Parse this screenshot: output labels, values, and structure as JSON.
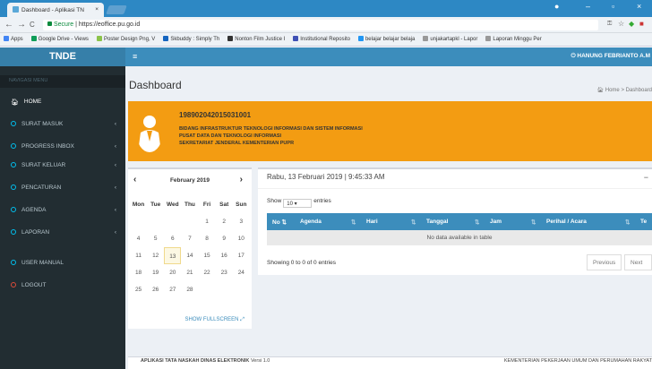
{
  "browser": {
    "tab_title": "Dashboard - Aplikasi TN",
    "tab_close": "×",
    "back": "←",
    "forward": "→",
    "reload": "C",
    "secure_label": "Secure",
    "url": "https://eoffice.pu.go.id",
    "bookmarks": [
      {
        "label": "Apps",
        "color": "#4285f4"
      },
      {
        "label": "Google Drive - Views",
        "color": "#0f9d58"
      },
      {
        "label": "Poster Design Png, V",
        "color": "#8bc34a"
      },
      {
        "label": "Skbuddy : Simply Th",
        "color": "#1565c0"
      },
      {
        "label": "Nonton Film Justice I",
        "color": "#333333"
      },
      {
        "label": "Institutional Reposito",
        "color": "#3f51b5"
      },
      {
        "label": "belajar belajar belaja",
        "color": "#2196f3"
      },
      {
        "label": "unjakartapkl - Lapor",
        "color": "#999999"
      },
      {
        "label": "Laporan Minggu Per",
        "color": "#999999"
      }
    ]
  },
  "app": {
    "logo": "TNDE",
    "hamburger": "≡",
    "user_name": "HANUNG FEBRIANTO A.M"
  },
  "sidebar": {
    "header": "NAVIGASI MENU",
    "items": [
      {
        "label": "HOME",
        "has_chevron": false
      },
      {
        "label": "SURAT MASUK",
        "has_chevron": true
      },
      {
        "label": "PROGRESS INBOX",
        "has_chevron": true
      },
      {
        "label": "SURAT KELUAR",
        "has_chevron": true
      },
      {
        "label": "PENCATURAN",
        "has_chevron": true
      },
      {
        "label": "AGENDA",
        "has_chevron": true
      },
      {
        "label": "LAPORAN",
        "has_chevron": true
      },
      {
        "label": "USER MANUAL",
        "has_chevron": false
      },
      {
        "label": "LOGOUT",
        "has_chevron": false
      }
    ],
    "chevron": "‹"
  },
  "page": {
    "title": "Dashboard",
    "breadcrumb_home": "Home",
    "breadcrumb_sep": ">",
    "breadcrumb_current": "Dashboard"
  },
  "profile": {
    "nip": "198902042015031001",
    "line1": "BIDANG INFRASTRUKTUR TEKNOLOGI INFORMASI DAN SISTEM INFORMASI",
    "line2": "PUSAT DATA DAN TEKNOLOGI INFORMASI",
    "line3": "SEKRETARIAT JENDERAL KEMENTERIAN PUPR"
  },
  "calendar": {
    "month": "February 2019",
    "prev": "‹",
    "next": "›",
    "weekdays": [
      "Mon",
      "Tue",
      "Wed",
      "Thu",
      "Fri",
      "Sat",
      "Sun"
    ],
    "weeks": [
      [
        "",
        "",
        "",
        "",
        "1",
        "2",
        "3"
      ],
      [
        "4",
        "5",
        "6",
        "7",
        "8",
        "9",
        "10"
      ],
      [
        "11",
        "12",
        "13",
        "14",
        "15",
        "16",
        "17"
      ],
      [
        "18",
        "19",
        "20",
        "21",
        "22",
        "23",
        "24"
      ],
      [
        "25",
        "26",
        "27",
        "28",
        "",
        "",
        ""
      ]
    ],
    "today": "13",
    "fullscreen_label": "SHOW FULLSCREEN"
  },
  "agenda_table": {
    "title": "Rabu, 13 Februari 2019 | 9:45:33 AM",
    "minimize": "−",
    "show_label": "Show",
    "entries_value": "10",
    "entries_label": "entries",
    "columns": [
      "No",
      "Agenda",
      "Hari",
      "Tanggal",
      "Jam",
      "Perihal / Acara",
      "Te"
    ],
    "empty_text": "No data available in table",
    "showing_text": "Showing 0 to 0 of 0 entries",
    "previous": "Previous",
    "next": "Next"
  },
  "footer": {
    "left_bold": "APLIKASI TATA NASKAH DINAS ELEKTRONIK",
    "left_version": "Versi 1.0",
    "right": "KEMENTERIAN PEKERJAAN UMUM DAN PERUMAHAN RAKYAT"
  }
}
